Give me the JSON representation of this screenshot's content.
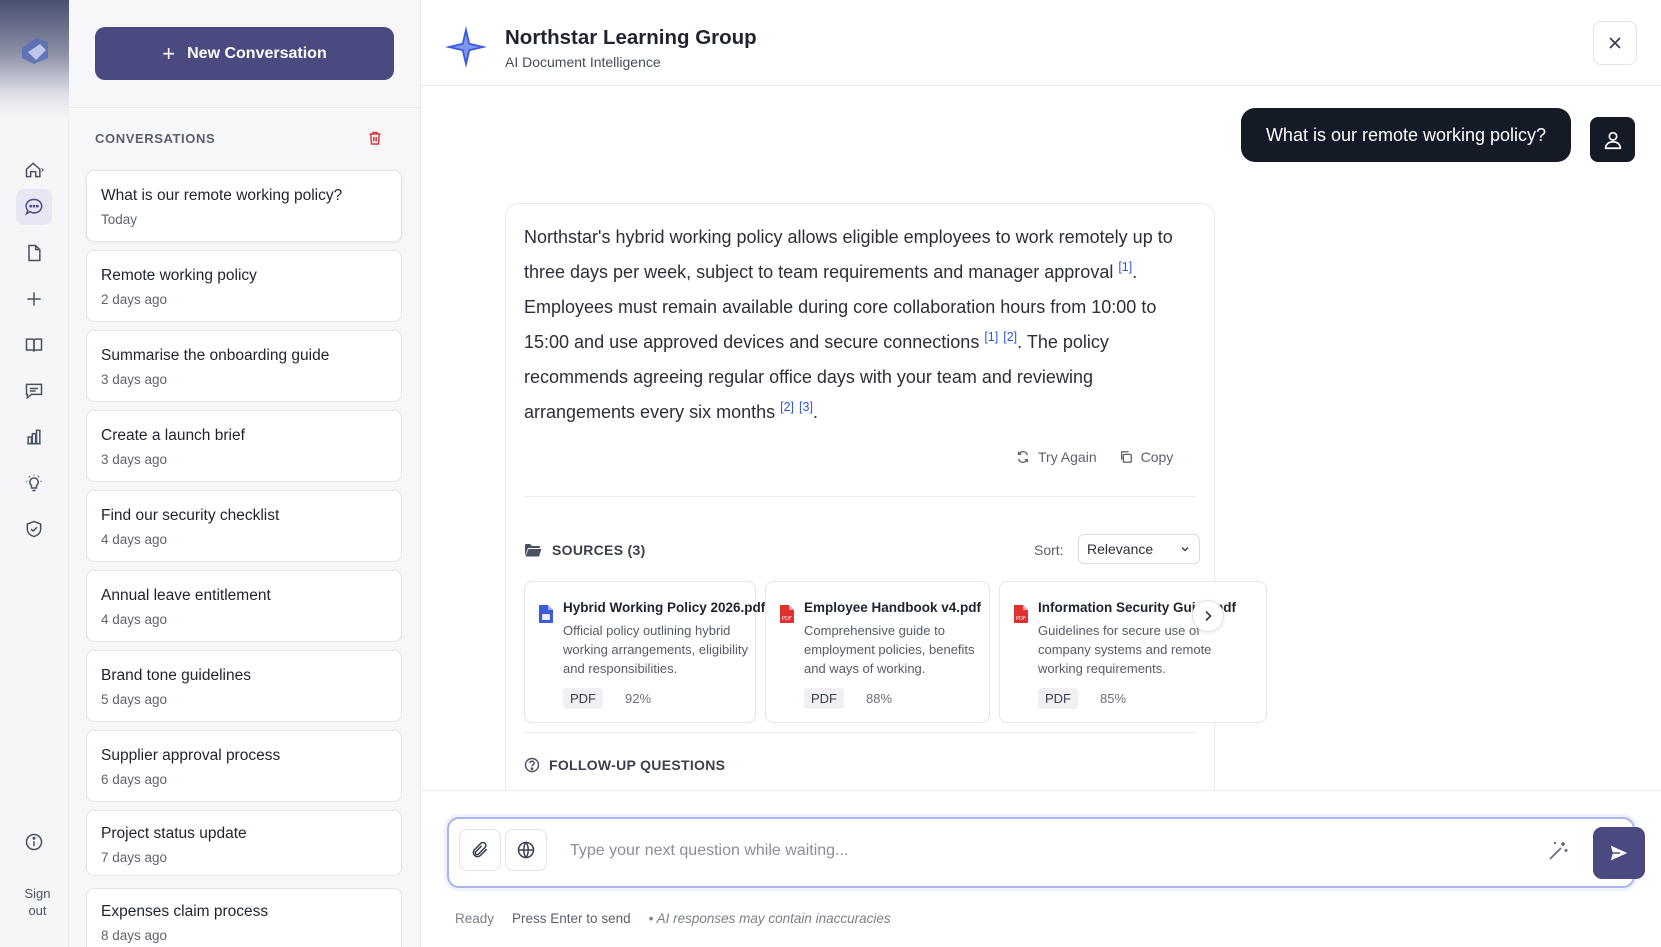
{
  "rail": {
    "items": [
      {
        "icon": "home-icon",
        "active": false
      },
      {
        "icon": "chat-icon",
        "active": true
      },
      {
        "icon": "document-icon",
        "active": false
      },
      {
        "icon": "plus-icon",
        "active": false
      },
      {
        "icon": "book-icon",
        "active": false
      },
      {
        "icon": "message-icon",
        "active": false
      },
      {
        "icon": "chart-icon",
        "active": false
      },
      {
        "icon": "lightbulb-icon",
        "active": false
      },
      {
        "icon": "shield-icon",
        "active": false
      }
    ],
    "info_icon": "info-icon",
    "signout_label_1": "Sign",
    "signout_label_2": "out"
  },
  "sidebar": {
    "new_button_label": "New Conversation",
    "heading": "CONVERSATIONS",
    "conversations": [
      {
        "title": "What is our remote working policy?",
        "date": "Today"
      },
      {
        "title": "Remote working policy",
        "date": "2 days ago"
      },
      {
        "title": "Summarise the onboarding guide",
        "date": "3 days ago"
      },
      {
        "title": "Create a launch brief",
        "date": "3 days ago"
      },
      {
        "title": "Find our security checklist",
        "date": "4 days ago"
      },
      {
        "title": "Annual leave entitlement",
        "date": "4 days ago"
      },
      {
        "title": "Brand tone guidelines",
        "date": "5 days ago"
      },
      {
        "title": "Supplier approval process",
        "date": "6 days ago"
      },
      {
        "title": "Project status update",
        "date": "7 days ago"
      },
      {
        "title": "Expenses claim process",
        "date": "8 days ago"
      }
    ]
  },
  "header": {
    "title": "Northstar Learning Group",
    "subtitle": "AI Document Intelligence"
  },
  "chat": {
    "user_message": "What is our remote working policy?",
    "answer": {
      "p1": "Northstar's hybrid working policy allows eligible employees to work remotely up to three days per week, subject to team requirements and manager approval ",
      "c1": "[1]",
      "p2": ". Employees must remain available during core collaboration hours from 10:00 to 15:00 and use approved devices and secure connections ",
      "c2": "[1]",
      "c3": "[2]",
      "p3": ". The policy recommends agreeing regular office days with your team and reviewing arrangements every six months ",
      "c4": "[2]",
      "c5": "[3]",
      "p4": "."
    },
    "try_again_label": "Try Again",
    "copy_label": "Copy",
    "sources_heading": "SOURCES (3)",
    "sort_label": "Sort:",
    "sort_value": "Relevance",
    "sources": [
      {
        "title": "Hybrid Working Policy 2026.pdf",
        "description": "Official policy outlining hybrid working arrangements, eligibility and responsibilities.",
        "type": "PDF",
        "score": "92%",
        "icon_color": "#3b5bdb"
      },
      {
        "title": "Employee Handbook v4.pdf",
        "description": "Comprehensive guide to employment policies, benefits and ways of working.",
        "type": "PDF",
        "score": "88%",
        "icon_color": "#e03131"
      },
      {
        "title": "Information Security Guide.pdf",
        "description": "Guidelines for secure use of company systems and remote working requirements.",
        "type": "PDF",
        "score": "85%",
        "icon_color": "#e03131"
      }
    ],
    "followup_heading": "FOLLOW-UP QUESTIONS"
  },
  "composer": {
    "placeholder": "Type your next question while waiting...",
    "status": "Ready",
    "hint": "Press Enter to send",
    "disclaimer": "• AI responses may contain inaccuracies"
  },
  "colors": {
    "accent": "#4b4a80",
    "user_bubble": "#141a26",
    "citation": "#2f58d6",
    "delete": "#d9363e"
  }
}
